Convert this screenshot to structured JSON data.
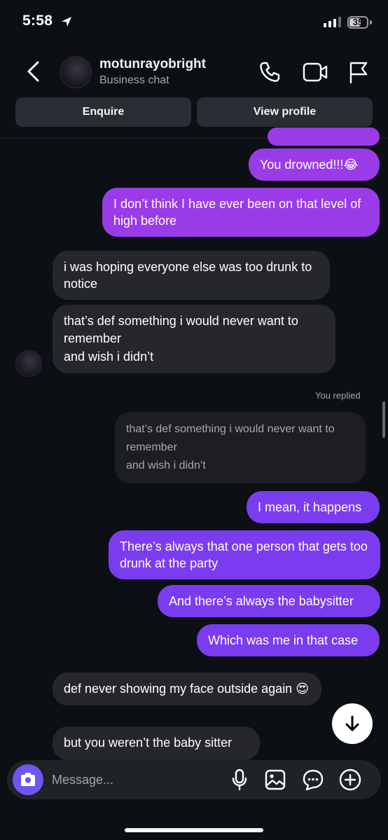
{
  "status_bar": {
    "time": "5:58",
    "battery": "35"
  },
  "header": {
    "username": "motunrayobright",
    "subtitle": "Business chat",
    "enquire_label": "Enquire",
    "view_profile_label": "View profile"
  },
  "messages": {
    "m1": "You drowned!!!😂",
    "m2": "I don’t think I have ever been on that level of high before",
    "m3": "i was hoping everyone else was too drunk to notice",
    "m4_line1": "that’s def something i would never want to remember",
    "m4_line2": "and wish i didn’t",
    "replied_label": "You replied",
    "reply_line1": "that’s def something i would never want to remember",
    "reply_line2": "and wish i didn’t",
    "m5": "I mean, it happens",
    "m6": "There’s always that one person that gets too drunk at the party",
    "m7": "And there’s always the babysitter",
    "m8": "Which was me in that case",
    "m9": "def never showing my face outside again 😍",
    "m10": "but you weren’t the baby sitter"
  },
  "composer": {
    "placeholder": "Message..."
  },
  "colors": {
    "sent_purple": "#9a3be8",
    "sent_violet": "#7b3cf0",
    "received": "#25272c",
    "camera_button": "#6f56f2"
  },
  "icons": [
    "location-arrow-icon",
    "back-chevron-icon",
    "phone-icon",
    "video-icon",
    "flag-icon",
    "arrow-down-icon",
    "camera-icon",
    "microphone-icon",
    "gallery-icon",
    "sticker-chat-icon",
    "plus-circle-icon"
  ]
}
